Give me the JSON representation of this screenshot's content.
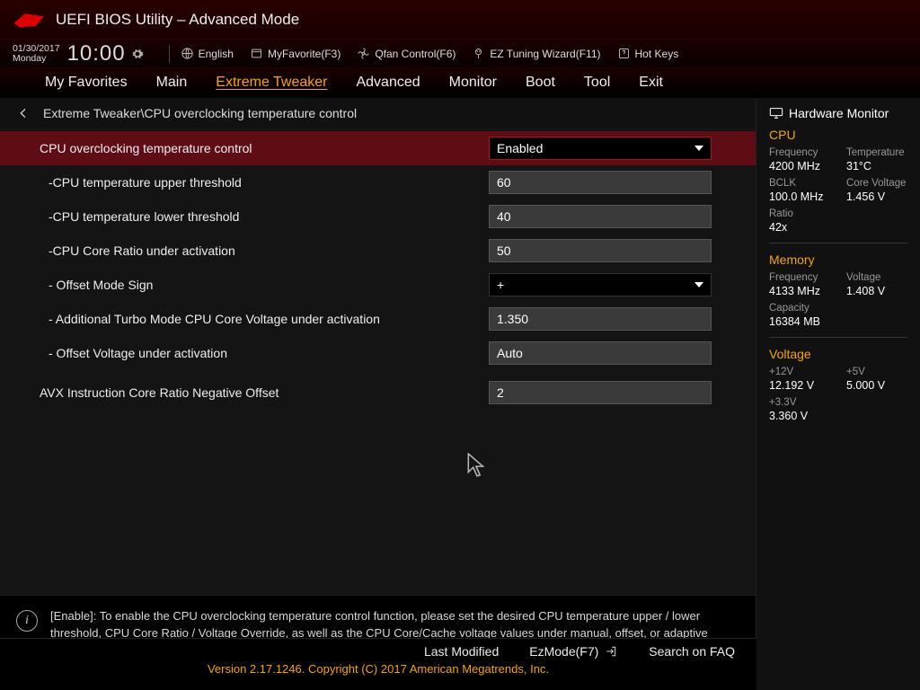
{
  "header": {
    "title": "UEFI BIOS Utility – Advanced Mode"
  },
  "datetime": {
    "date": "01/30/2017",
    "day": "Monday",
    "time": "10:00"
  },
  "infobar": {
    "language": "English",
    "favorite": "MyFavorite(F3)",
    "qfan": "Qfan Control(F6)",
    "eztune": "EZ Tuning Wizard(F11)",
    "hotkeys": "Hot Keys"
  },
  "tabs": [
    "My Favorites",
    "Main",
    "Extreme Tweaker",
    "Advanced",
    "Monitor",
    "Boot",
    "Tool",
    "Exit"
  ],
  "active_tab": "Extreme Tweaker",
  "breadcrumb": "Extreme Tweaker\\CPU overclocking temperature control",
  "settings": [
    {
      "label": "CPU overclocking temperature control",
      "value": "Enabled",
      "type": "select",
      "hl": true,
      "indent": 0
    },
    {
      "label": "-CPU temperature upper threshold",
      "value": "60",
      "type": "text",
      "indent": 1
    },
    {
      "label": "-CPU temperature lower threshold",
      "value": "40",
      "type": "text",
      "indent": 1
    },
    {
      "label": "-CPU Core Ratio under activation",
      "value": "50",
      "type": "text",
      "indent": 1
    },
    {
      "label": "- Offset Mode Sign",
      "value": "+",
      "type": "select",
      "indent": 1
    },
    {
      "label": "- Additional Turbo Mode CPU Core Voltage under activation",
      "value": "1.350",
      "type": "text",
      "indent": 1
    },
    {
      "label": "- Offset Voltage under activation",
      "value": "Auto",
      "type": "text",
      "indent": 1
    },
    {
      "label": "AVX Instruction Core Ratio Negative Offset",
      "value": "2",
      "type": "text",
      "indent": 0
    }
  ],
  "help": "[Enable]: To enable the CPU overclocking temperature control function, please set the desired CPU temperature upper / lower threshold, CPU Core Ratio / Voltage Override, as well as the CPU Core/Cache voltage values under manual, offset, or adaptive mode. [Disable]: Disables the CPU overclocking temperature control function.",
  "sidebar": {
    "title": "Hardware Monitor",
    "cpu": {
      "title": "CPU",
      "freq_k": "Frequency",
      "freq_v": "4200 MHz",
      "temp_k": "Temperature",
      "temp_v": "31°C",
      "bclk_k": "BCLK",
      "bclk_v": "100.0 MHz",
      "vcore_k": "Core Voltage",
      "vcore_v": "1.456 V",
      "ratio_k": "Ratio",
      "ratio_v": "42x"
    },
    "mem": {
      "title": "Memory",
      "freq_k": "Frequency",
      "freq_v": "4133 MHz",
      "volt_k": "Voltage",
      "volt_v": "1.408 V",
      "cap_k": "Capacity",
      "cap_v": "16384 MB"
    },
    "volt": {
      "title": "Voltage",
      "p12_k": "+12V",
      "p12_v": "12.192 V",
      "p5_k": "+5V",
      "p5_v": "5.000 V",
      "p33_k": "+3.3V",
      "p33_v": "3.360 V"
    }
  },
  "footer": {
    "last": "Last Modified",
    "ez": "EzMode(F7)",
    "faq": "Search on FAQ",
    "version": "Version 2.17.1246. Copyright (C) 2017 American Megatrends, Inc."
  }
}
